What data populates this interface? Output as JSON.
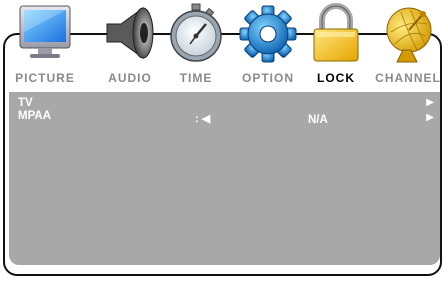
{
  "tabs": [
    {
      "label": "PICTURE",
      "icon": "picture-monitor-icon"
    },
    {
      "label": "AUDIO",
      "icon": "speaker-icon"
    },
    {
      "label": "TIME",
      "icon": "stopwatch-icon"
    },
    {
      "label": "OPTION",
      "icon": "gear-icon"
    },
    {
      "label": "LOCK",
      "icon": "padlock-icon",
      "active": true
    },
    {
      "label": "CHANNEL",
      "icon": "satellite-dish-icon"
    }
  ],
  "panel": {
    "rows": [
      {
        "label": "TV",
        "right_arrow": "▶"
      },
      {
        "label": "MPAA",
        "prefix": ": ◀",
        "value": "N/A",
        "right_arrow": "▶"
      }
    ]
  }
}
